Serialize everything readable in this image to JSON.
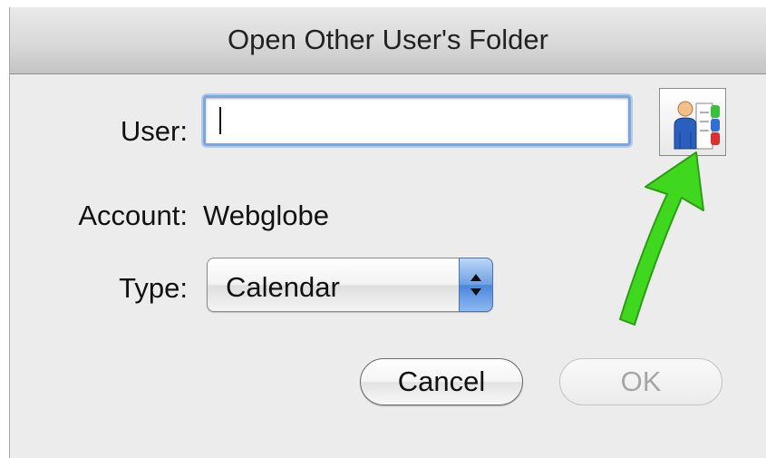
{
  "dialog": {
    "title": "Open Other User's Folder"
  },
  "form": {
    "user_label": "User:",
    "user_value": "",
    "account_label": "Account:",
    "account_value": "Webglobe",
    "type_label": "Type:",
    "type_selected": "Calendar"
  },
  "buttons": {
    "cancel_label": "Cancel",
    "ok_label": "OK"
  },
  "icons": {
    "address_book": "address-book-icon",
    "popup_arrows": "chevron-updown-icon",
    "annotation": "green-arrow-annotation"
  },
  "colors": {
    "annotation_arrow": "#3fd81e",
    "focus_ring": "#7fa6d8",
    "popup_accent": "#4a86dc",
    "disabled_text": "#a6a6a6"
  }
}
